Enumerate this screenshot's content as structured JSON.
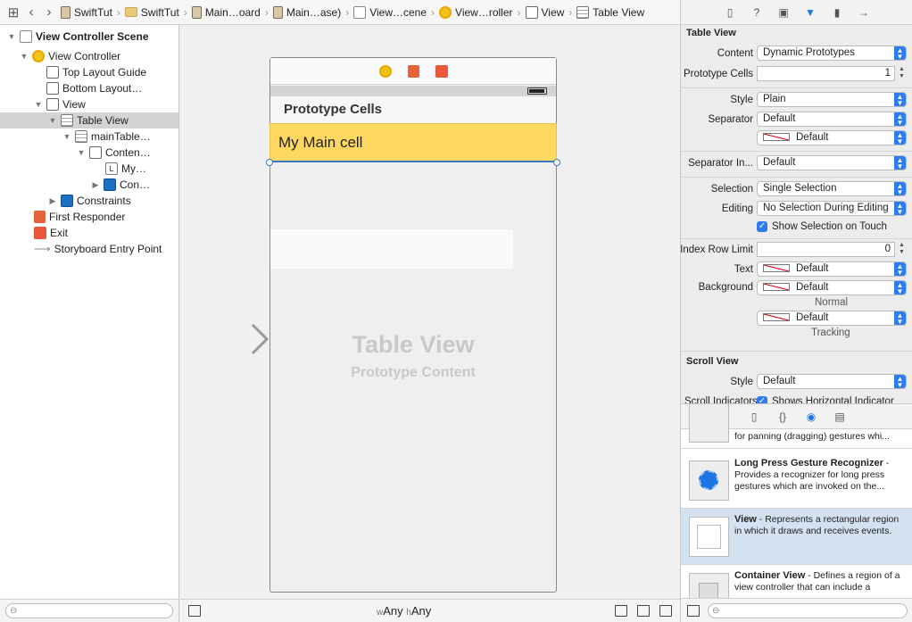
{
  "jumpbar": {
    "items": [
      {
        "label": "SwiftTut",
        "icon": "project-icon"
      },
      {
        "label": "SwiftTut",
        "icon": "folder-icon"
      },
      {
        "label": "Main…oard",
        "icon": "storyboard-icon"
      },
      {
        "label": "Main…ase)",
        "icon": "storyboard-icon"
      },
      {
        "label": "View…cene",
        "icon": "scene-icon"
      },
      {
        "label": "View…roller",
        "icon": "view-controller-icon"
      },
      {
        "label": "View",
        "icon": "view-icon"
      },
      {
        "label": "Table View",
        "icon": "table-view-icon"
      }
    ]
  },
  "outline": {
    "scene": "View Controller Scene",
    "view_controller": "View Controller",
    "top_layout_guide": "Top Layout Guide",
    "bottom_layout": "Bottom Layout…",
    "view": "View",
    "table_view": "Table View",
    "main_table": "mainTable…",
    "content": "Conten…",
    "my_label": "My…",
    "con": "Con…",
    "constraints": "Constraints",
    "first_responder": "First Responder",
    "exit": "Exit",
    "entry_point": "Storyboard Entry Point"
  },
  "canvas": {
    "section_header": "Prototype Cells",
    "main_cell": "My Main cell",
    "placeholder_title": "Table View",
    "placeholder_subtitle": "Prototype Content",
    "size_w_prefix": "w",
    "size_w": "Any",
    "size_h_prefix": "h",
    "size_h": "Any"
  },
  "inspector": {
    "table_view_title": "Table View",
    "content_label": "Content",
    "content_value": "Dynamic Prototypes",
    "prototype_cells_label": "Prototype Cells",
    "prototype_cells_value": "1",
    "style_label": "Style",
    "style_value": "Plain",
    "separator_label": "Separator",
    "separator_value": "Default",
    "separator_color": "Default",
    "separator_inset_label": "Separator In...",
    "separator_inset_value": "Default",
    "selection_label": "Selection",
    "selection_value": "Single Selection",
    "editing_label": "Editing",
    "editing_value": "No Selection During Editing",
    "show_selection_label": "Show Selection on Touch",
    "index_row_limit_label": "Index Row Limit",
    "index_row_limit_value": "0",
    "text_label": "Text",
    "text_value": "Default",
    "background_label": "Background",
    "background_normal_value": "Default",
    "normal_caption": "Normal",
    "background_tracking_value": "Default",
    "tracking_caption": "Tracking",
    "scroll_view_title": "Scroll View",
    "scroll_style_label": "Style",
    "scroll_style_value": "Default",
    "scroll_indicators_label": "Scroll Indicators",
    "scroll_indicators_value": "Shows Horizontal Indicator"
  },
  "library": {
    "items": [
      {
        "title": "",
        "desc": "for panning (dragging) gestures whi..."
      },
      {
        "title": "Long Press Gesture Recognizer",
        "desc": " - Provides a recognizer for long press gestures which are invoked on the..."
      },
      {
        "title": "View",
        "desc": " - Represents a rectangular region in which it draws and receives events."
      },
      {
        "title": "Container View",
        "desc": " - Defines a region of a view controller that can include a"
      }
    ]
  }
}
